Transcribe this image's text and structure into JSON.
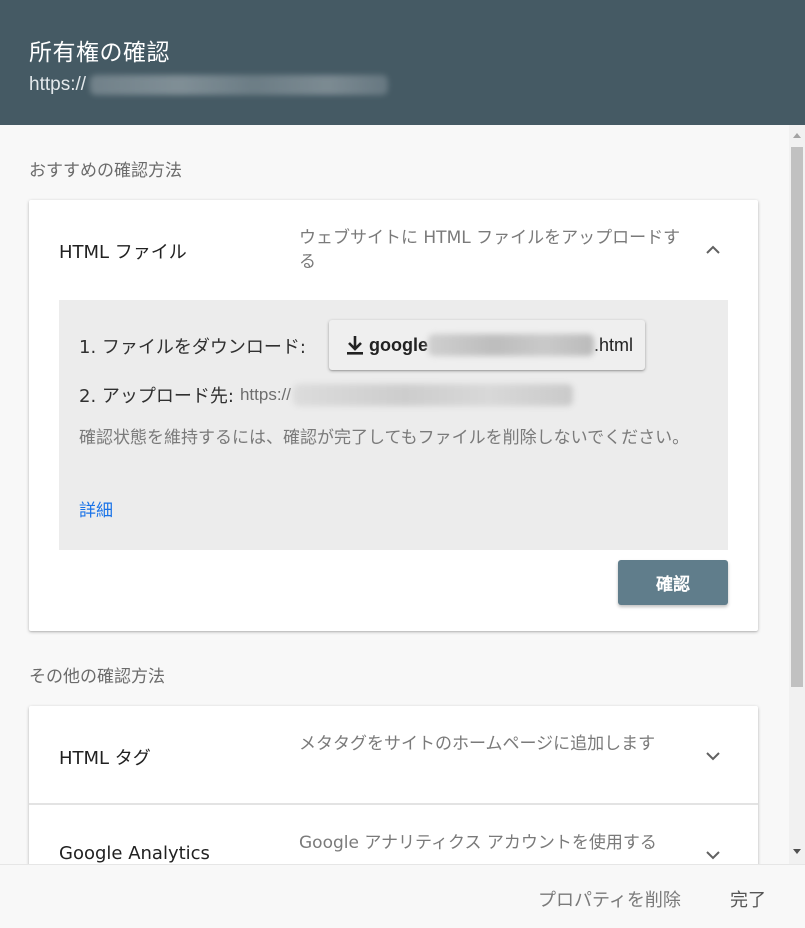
{
  "dialog": {
    "title": "所有権の確認",
    "url_prefix": "https://"
  },
  "recommended": {
    "section_label": "おすすめの確認方法",
    "method": {
      "name": "HTML ファイル",
      "description": "ウェブサイトに HTML ファイルをアップロードする",
      "expanded": true,
      "step1_label": "1. ファイルをダウンロード:",
      "download_prefix": "google",
      "download_suffix": ".html",
      "step2_label": "2. アップロード先:",
      "step2_url_prefix": "https://",
      "note": "確認状態を維持するには、確認が完了してもファイルを削除しないでください。",
      "details_link": "詳細",
      "confirm_button": "確認"
    }
  },
  "other": {
    "section_label": "その他の確認方法",
    "methods": [
      {
        "name": "HTML タグ",
        "description": "メタタグをサイトのホームページに追加します"
      },
      {
        "name": "Google Analytics",
        "description": "Google アナリティクス アカウントを使用する"
      }
    ]
  },
  "footer": {
    "delete_property": "プロパティを削除",
    "done": "完了"
  },
  "colors": {
    "header_bg": "#455a64",
    "confirm_button_bg": "#607d8b",
    "link": "#1a73e8"
  }
}
